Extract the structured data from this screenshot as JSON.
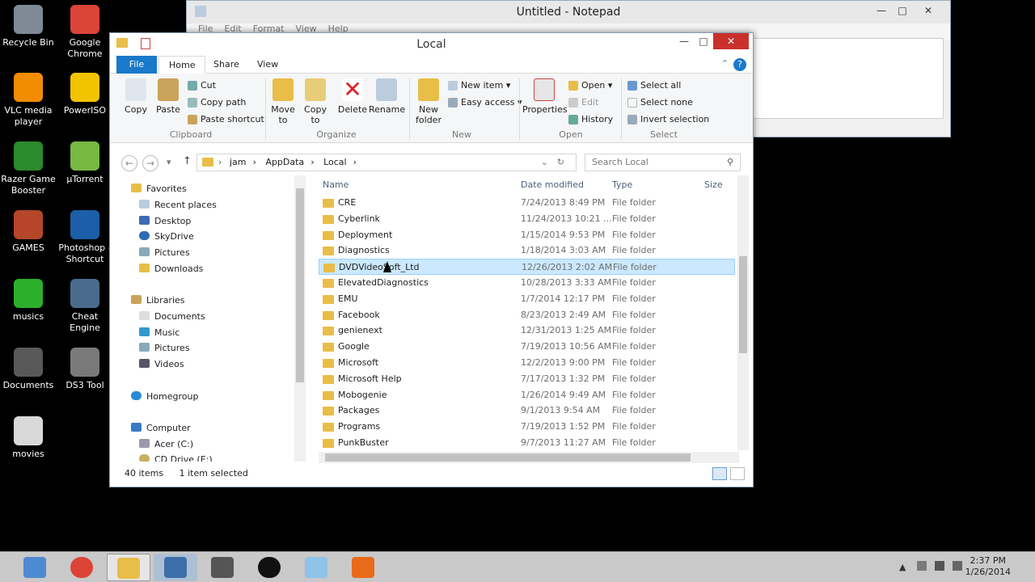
{
  "desktop": {
    "icons": [
      {
        "label": "Recycle Bin",
        "color": "#7f8a96"
      },
      {
        "label": "Google Chrome",
        "color": "#db4437"
      },
      {
        "label": "VLC media player",
        "color": "#f28c00"
      },
      {
        "label": "PowerISO",
        "color": "#f2c400"
      },
      {
        "label": "Razer Game Booster",
        "color": "#2b8a2b"
      },
      {
        "label": "µTorrent",
        "color": "#78b843"
      },
      {
        "label": "GAMES",
        "color": "#b5462a"
      },
      {
        "label": "Photoshop - Shortcut",
        "color": "#1c5fa8"
      },
      {
        "label": "musics",
        "color": "#2bb02b"
      },
      {
        "label": "Cheat Engine",
        "color": "#4a6b8e"
      },
      {
        "label": "Documents",
        "color": "#59595a"
      },
      {
        "label": "DS3 Tool",
        "color": "#7a7a7a"
      },
      {
        "label": "movies",
        "color": "#d8d8d8"
      }
    ]
  },
  "notepad": {
    "title": "Untitled - Notepad",
    "menu": [
      "File",
      "Edit",
      "Format",
      "View",
      "Help"
    ]
  },
  "explorer": {
    "title": "Local",
    "tabs": {
      "file": "File",
      "home": "Home",
      "share": "Share",
      "view": "View"
    },
    "ribbon": {
      "copy": "Copy",
      "paste": "Paste",
      "cut": "Cut",
      "copy_path": "Copy path",
      "paste_shortcut": "Paste shortcut",
      "move_to": "Move to",
      "copy_to": "Copy to",
      "delete": "Delete",
      "rename": "Rename",
      "new_folder": "New folder",
      "new_item": "New item",
      "easy_access": "Easy access",
      "properties": "Properties",
      "open": "Open",
      "edit": "Edit",
      "history": "History",
      "select_all": "Select all",
      "select_none": "Select none",
      "invert_selection": "Invert selection",
      "groups": {
        "clipboard": "Clipboard",
        "organize": "Organize",
        "new": "New",
        "open": "Open",
        "select": "Select"
      }
    },
    "address": {
      "path": [
        "jam",
        "AppData",
        "Local"
      ]
    },
    "search_placeholder": "Search Local",
    "nav": {
      "favorites": "Favorites",
      "recent": "Recent places",
      "desktop": "Desktop",
      "skydrive": "SkyDrive",
      "pictures": "Pictures",
      "downloads": "Downloads",
      "libraries": "Libraries",
      "documents": "Documents",
      "music": "Music",
      "lib_pictures": "Pictures",
      "videos": "Videos",
      "homegroup": "Homegroup",
      "computer": "Computer",
      "acer": "Acer (C:)",
      "cddrive": "CD Drive (E:)"
    },
    "columns": {
      "name": "Name",
      "date": "Date modified",
      "type": "Type",
      "size": "Size"
    },
    "files": [
      {
        "name": "CRE",
        "date": "7/24/2013 8:49 PM",
        "type": "File folder"
      },
      {
        "name": "Cyberlink",
        "date": "11/24/2013 10:21 ...",
        "type": "File folder"
      },
      {
        "name": "Deployment",
        "date": "1/15/2014 9:53 PM",
        "type": "File folder"
      },
      {
        "name": "Diagnostics",
        "date": "1/18/2014 3:03 AM",
        "type": "File folder"
      },
      {
        "name": "DVDVideoSoft_Ltd",
        "date": "12/26/2013 2:02 AM",
        "type": "File folder"
      },
      {
        "name": "ElevatedDiagnostics",
        "date": "10/28/2013 3:33 AM",
        "type": "File folder"
      },
      {
        "name": "EMU",
        "date": "1/7/2014 12:17 PM",
        "type": "File folder"
      },
      {
        "name": "Facebook",
        "date": "8/23/2013 2:49 AM",
        "type": "File folder"
      },
      {
        "name": "genienext",
        "date": "12/31/2013 1:25 AM",
        "type": "File folder"
      },
      {
        "name": "Google",
        "date": "7/19/2013 10:56 AM",
        "type": "File folder"
      },
      {
        "name": "Microsoft",
        "date": "12/2/2013 9:00 PM",
        "type": "File folder"
      },
      {
        "name": "Microsoft Help",
        "date": "7/17/2013 1:32 PM",
        "type": "File folder"
      },
      {
        "name": "Mobogenie",
        "date": "1/26/2014 9:49 AM",
        "type": "File folder"
      },
      {
        "name": "Packages",
        "date": "9/1/2013 9:54 AM",
        "type": "File folder"
      },
      {
        "name": "Programs",
        "date": "7/19/2013 1:52 PM",
        "type": "File folder"
      },
      {
        "name": "PunkBuster",
        "date": "9/7/2013 11:27 AM",
        "type": "File folder"
      }
    ],
    "selected_index": 4,
    "status": {
      "items": "40 items",
      "selected": "1 item selected"
    }
  },
  "taskbar": {
    "time": "2:37 PM",
    "date": "1/26/2014"
  }
}
